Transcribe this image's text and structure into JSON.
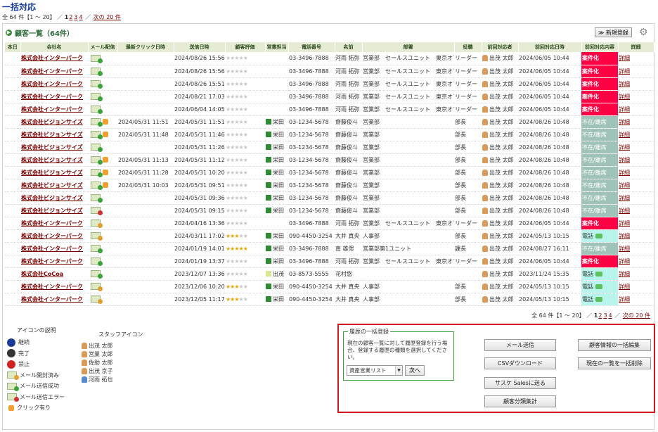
{
  "page": {
    "title": "一括対応"
  },
  "pager": {
    "prefix": "全 64 件【1 ～ 20】 ／",
    "pages": [
      "1",
      "2",
      "3",
      "4"
    ],
    "sep": "／",
    "next": "次の 20 件"
  },
  "list": {
    "title": "顧客一覧（64件）",
    "new_button": "≫ 新規登録"
  },
  "columns": [
    "本日",
    "会社名",
    "メール配信",
    "最新クリック日時",
    "送信日時",
    "顧客評価",
    "営業担当",
    "電話番号",
    "名前",
    "部署",
    "役職",
    "前回対応者",
    "前回対応日時",
    "前回対応内容",
    "詳細"
  ],
  "rows": [
    {
      "company": "株式会社インターパーク",
      "mail": "ok",
      "click": false,
      "click_date": "",
      "sent": "2024/08/26 15:56",
      "stars": 0,
      "staff": "",
      "phone": "03-3496-7888",
      "name": "河雨 拓弥",
      "dept": "営業部　セールスユニット　東京オフィス",
      "title": "リーダー",
      "prev_person": "出茂 太郎",
      "prev_date": "2024/06/05 10:44",
      "status": "案件化",
      "status_type": "red",
      "detail": "詳細"
    },
    {
      "company": "株式会社インターパーク",
      "mail": "ok",
      "click": false,
      "click_date": "",
      "sent": "2024/08/26 15:56",
      "stars": 0,
      "staff": "",
      "phone": "03-3496-7888",
      "name": "河雨 拓弥",
      "dept": "営業部　セールスユニット　東京オフィス",
      "title": "リーダー",
      "prev_person": "出茂 太郎",
      "prev_date": "2024/06/05 10:44",
      "status": "案件化",
      "status_type": "red",
      "detail": "詳細"
    },
    {
      "company": "株式会社インターパーク",
      "mail": "ok",
      "click": false,
      "click_date": "",
      "sent": "2024/08/26 15:51",
      "stars": 0,
      "staff": "",
      "phone": "03-3496-7888",
      "name": "河雨 拓弥",
      "dept": "営業部　セールスユニット　東京オフィス",
      "title": "リーダー",
      "prev_person": "出茂 太郎",
      "prev_date": "2024/06/05 10:44",
      "status": "案件化",
      "status_type": "red",
      "detail": "詳細"
    },
    {
      "company": "株式会社インターパーク",
      "mail": "ok",
      "click": false,
      "click_date": "",
      "sent": "2024/08/21 17:03",
      "stars": 0,
      "staff": "",
      "phone": "03-3496-7888",
      "name": "河雨 拓弥",
      "dept": "営業部　セールスユニット　東京オフィス",
      "title": "リーダー",
      "prev_person": "出茂 太郎",
      "prev_date": "2024/06/05 10:44",
      "status": "案件化",
      "status_type": "red",
      "detail": "詳細"
    },
    {
      "company": "株式会社インターパーク",
      "mail": "ok",
      "click": false,
      "click_date": "",
      "sent": "2024/06/04 14:05",
      "stars": 0,
      "staff": "",
      "phone": "03-3496-7888",
      "name": "河雨 拓弥",
      "dept": "営業部　セールスユニット　東京オフィス",
      "title": "リーダー",
      "prev_person": "出茂 太郎",
      "prev_date": "2024/06/05 10:44",
      "status": "案件化",
      "status_type": "red",
      "detail": "詳細"
    },
    {
      "company": "株式会社ビジョンサイズ",
      "mail": "ok",
      "click": true,
      "click_date": "2024/05/31 11:51",
      "sent": "2024/05/31 11:51",
      "stars": 0,
      "staff": "栄田",
      "phone": "03-1234-5678",
      "name": "齋藤俊斗",
      "dept": "営業部",
      "title": "部長",
      "prev_person": "出茂 太郎",
      "prev_date": "2024/08/26 10:48",
      "status": "不在/離席",
      "status_type": "gray",
      "detail": "詳細"
    },
    {
      "company": "株式会社ビジョンサイズ",
      "mail": "ok",
      "click": true,
      "click_date": "2024/05/31 11:48",
      "sent": "2024/05/31 11:46",
      "stars": 0,
      "staff": "栄田",
      "phone": "03-1234-5678",
      "name": "齋藤俊斗",
      "dept": "営業部",
      "title": "部長",
      "prev_person": "出茂 太郎",
      "prev_date": "2024/08/26 10:48",
      "status": "不在/離席",
      "status_type": "gray",
      "detail": "詳細"
    },
    {
      "company": "株式会社ビジョンサイズ",
      "mail": "ok",
      "click": false,
      "click_date": "",
      "sent": "2024/05/31 11:26",
      "stars": 0,
      "staff": "栄田",
      "phone": "03-1234-5678",
      "name": "齋藤俊斗",
      "dept": "営業部",
      "title": "部長",
      "prev_person": "出茂 太郎",
      "prev_date": "2024/08/26 10:48",
      "status": "不在/離席",
      "status_type": "gray",
      "detail": "詳細"
    },
    {
      "company": "株式会社ビジョンサイズ",
      "mail": "ok",
      "click": true,
      "click_date": "2024/05/31 11:13",
      "sent": "2024/05/31 11:12",
      "stars": 0,
      "staff": "栄田",
      "phone": "03-1234-5678",
      "name": "齋藤俊斗",
      "dept": "営業部",
      "title": "部長",
      "prev_person": "出茂 太郎",
      "prev_date": "2024/08/26 10:48",
      "status": "不在/離席",
      "status_type": "gray",
      "detail": "詳細"
    },
    {
      "company": "株式会社ビジョンサイズ",
      "mail": "ok",
      "click": true,
      "click_date": "2024/05/31 11:28",
      "sent": "2024/05/31 10:20",
      "stars": 0,
      "staff": "栄田",
      "phone": "03-1234-5678",
      "name": "齋藤俊斗",
      "dept": "営業部",
      "title": "部長",
      "prev_person": "出茂 太郎",
      "prev_date": "2024/08/26 10:48",
      "status": "不在/離席",
      "status_type": "gray",
      "detail": "詳細"
    },
    {
      "company": "株式会社ビジョンサイズ",
      "mail": "ok",
      "click": true,
      "click_date": "2024/05/31 10:03",
      "sent": "2024/05/31 09:51",
      "stars": 0,
      "staff": "栄田",
      "phone": "03-1234-5678",
      "name": "齋藤俊斗",
      "dept": "営業部",
      "title": "部長",
      "prev_person": "出茂 太郎",
      "prev_date": "2024/08/26 10:48",
      "status": "不在/離席",
      "status_type": "gray",
      "detail": "詳細"
    },
    {
      "company": "株式会社ビジョンサイズ",
      "mail": "ok",
      "click": false,
      "click_date": "",
      "sent": "2024/05/31 09:36",
      "stars": 0,
      "staff": "栄田",
      "phone": "03-1234-5678",
      "name": "齋藤俊斗",
      "dept": "営業部",
      "title": "部長",
      "prev_person": "出茂 太郎",
      "prev_date": "2024/08/26 10:48",
      "status": "不在/離席",
      "status_type": "gray",
      "detail": "詳細"
    },
    {
      "company": "株式会社ビジョンサイズ",
      "mail": "err",
      "click": false,
      "click_date": "",
      "sent": "2024/05/31 09:15",
      "stars": 0,
      "staff": "栄田",
      "phone": "03-1234-5678",
      "name": "齋藤俊斗",
      "dept": "営業部",
      "title": "部長",
      "prev_person": "出茂 太郎",
      "prev_date": "2024/08/26 10:48",
      "status": "不在/離席",
      "status_type": "gray",
      "detail": "詳細"
    },
    {
      "company": "株式会社インターパーク",
      "mail": "read",
      "click": false,
      "click_date": "",
      "sent": "2024/04/16 13:36",
      "stars": 0,
      "staff": "",
      "phone": "03-3496-7888",
      "name": "河雨 拓弥",
      "dept": "営業部　セールスユニット　東京オフィス",
      "title": "リーダー",
      "prev_person": "出茂 太郎",
      "prev_date": "2024/06/05 10:44",
      "status": "案件化",
      "status_type": "red",
      "detail": "詳細"
    },
    {
      "company": "株式会社インターパーク",
      "mail": "read",
      "click": false,
      "click_date": "",
      "sent": "2024/03/11 17:02",
      "stars": 3,
      "staff": "栄田",
      "phone": "090-4450-3254",
      "name": "大井 真央",
      "dept": "人事部",
      "title": "部長",
      "prev_person": "出茂 太郎",
      "prev_date": "2024/05/13 10:15",
      "status": "電話",
      "status_type": "cyan",
      "detail": "詳細"
    },
    {
      "company": "株式会社インターパーク",
      "mail": "ok",
      "click": false,
      "click_date": "",
      "sent": "2024/01/19 14:01",
      "stars": 5,
      "staff": "栄田",
      "phone": "03-3496-7888",
      "name": "南 雄偲",
      "dept": "営業部第1ユニット",
      "title": "課長",
      "prev_person": "出茂 太郎",
      "prev_date": "2024/08/27 16:11",
      "status": "不在/離席",
      "status_type": "gray",
      "detail": "詳細"
    },
    {
      "company": "株式会社インターパーク",
      "mail": "ok",
      "click": false,
      "click_date": "",
      "sent": "2024/01/19 13:37",
      "stars": 0,
      "staff": "栄田",
      "phone": "03-3496-7888",
      "name": "河雨 拓弥",
      "dept": "営業部　セールスユニット　東京オフィス",
      "title": "リーダー",
      "prev_person": "出茂 太郎",
      "prev_date": "2024/06/05 10:44",
      "status": "案件化",
      "status_type": "red",
      "detail": "詳細"
    },
    {
      "company": "株式会社CoCoa",
      "mail": "ok",
      "click": false,
      "click_date": "",
      "sent": "2023/12/07 13:36",
      "stars": 0,
      "staff": "出茂",
      "staff_light": true,
      "phone": "03-8573-5555",
      "name": "花村悠",
      "dept": "",
      "title": "",
      "prev_person": "出茂 太郎",
      "prev_date": "2023/11/24 15:35",
      "status": "電話",
      "status_type": "cyan",
      "detail": "詳細"
    },
    {
      "company": "株式会社インターパーク",
      "mail": "read",
      "click": false,
      "click_date": "",
      "sent": "2023/12/06 10:20",
      "stars": 3,
      "staff": "栄田",
      "phone": "090-4450-3254",
      "name": "大井 真央",
      "dept": "人事部",
      "title": "部長",
      "prev_person": "出茂 太郎",
      "prev_date": "2024/05/13 10:15",
      "status": "電話",
      "status_type": "cyan",
      "detail": "詳細"
    },
    {
      "company": "株式会社インターパーク",
      "mail": "read",
      "click": false,
      "click_date": "",
      "sent": "2023/12/05 11:17",
      "stars": 3,
      "staff": "栄田",
      "phone": "090-4450-3254",
      "name": "大井 真央",
      "dept": "人事部",
      "title": "部長",
      "prev_person": "出茂 太郎",
      "prev_date": "2024/05/13 10:15",
      "status": "電話",
      "status_type": "cyan",
      "detail": "詳細"
    }
  ],
  "legend": {
    "title": "アイコンの説明",
    "items": [
      {
        "label": "継続",
        "icon": "continue-icon"
      },
      {
        "label": "完了",
        "icon": "complete-icon"
      },
      {
        "label": "禁止",
        "icon": "prohibited-icon"
      },
      {
        "label": "メール開封済み",
        "icon": "mail-opened-icon"
      },
      {
        "label": "メール送信成功",
        "icon": "mail-sent-icon"
      },
      {
        "label": "メール送信エラー",
        "icon": "mail-error-icon"
      },
      {
        "label": "クリック有り",
        "icon": "click-icon"
      }
    ]
  },
  "staff": {
    "title": "スタッフアイコン",
    "items": [
      "出茂 太郎",
      "営業 太郎",
      "佐助 太郎",
      "出茂 京子",
      "河雨 拓也"
    ]
  },
  "bulk": {
    "title": "履歴の一括登録",
    "desc": "現在の顧客一覧に対して履歴登録を行う場合、登録する履歴の種類を選択してください。",
    "select_value": "資産営業リスト",
    "next": "次へ"
  },
  "actions": {
    "mail": "メール送信",
    "csv": "CSVダウンロード",
    "sasuke": "サスケ Salesに送る",
    "category": "顧客分類集計",
    "bulk_edit": "顧客情報の一括編集",
    "bulk_delete": "現在の一覧を一括削除"
  },
  "colors": {
    "accent_green": "#2e6a3a",
    "alert_red": "#d0191e",
    "status_red": "#ff0044",
    "status_gray": "#9fc3b8",
    "status_cyan": "#b9f5ec"
  }
}
